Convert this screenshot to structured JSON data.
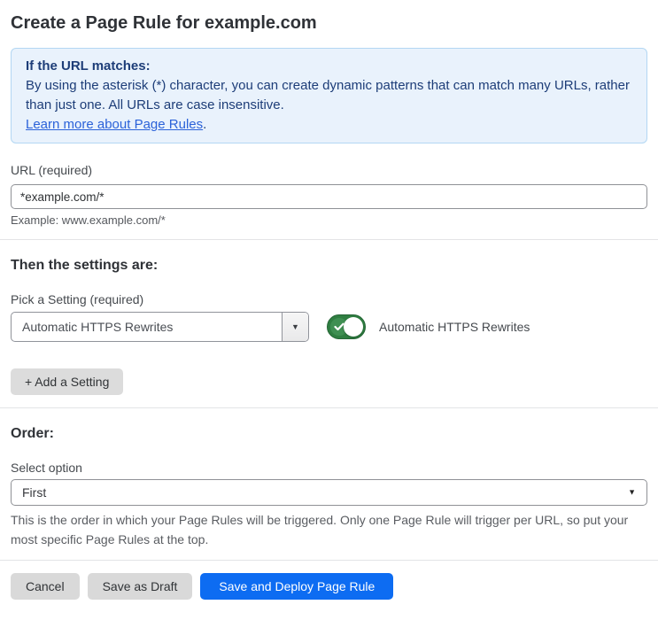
{
  "page": {
    "title": "Create a Page Rule for example.com"
  },
  "info_box": {
    "heading": "If the URL matches:",
    "body": "By using the asterisk (*) character, you can create dynamic patterns that can match many URLs, rather than just one. All URLs are case insensitive.",
    "link_label": "Learn more about Page Rules",
    "link_suffix": "."
  },
  "url_field": {
    "label": "URL (required)",
    "value": "*example.com/*",
    "helper": "Example: www.example.com/*"
  },
  "settings_section": {
    "heading": "Then the settings are:",
    "picker_label": "Pick a Setting (required)",
    "picker_value": "Automatic HTTPS Rewrites",
    "toggle_label": "Automatic HTTPS Rewrites",
    "toggle_state": "on",
    "add_setting_button": "+ Add a Setting"
  },
  "order_section": {
    "heading": "Order:",
    "select_label": "Select option",
    "select_value": "First",
    "helper": "This is the order in which your Page Rules will be triggered. Only one Page Rule will trigger per URL, so put your most specific Page Rules at the top."
  },
  "footer": {
    "cancel_label": "Cancel",
    "save_draft_label": "Save as Draft",
    "save_deploy_label": "Save and Deploy Page Rule"
  },
  "icons": {
    "dropdown_arrow": "▼",
    "check": "✓"
  },
  "colors": {
    "accent_blue": "#0d6cf2",
    "info_bg": "#e9f2fc",
    "info_border": "#b3d7f3",
    "info_text": "#1d3d78",
    "link_blue": "#2b62d9",
    "toggle_green": "#2f7e41",
    "button_gray": "#d9d9d9"
  }
}
